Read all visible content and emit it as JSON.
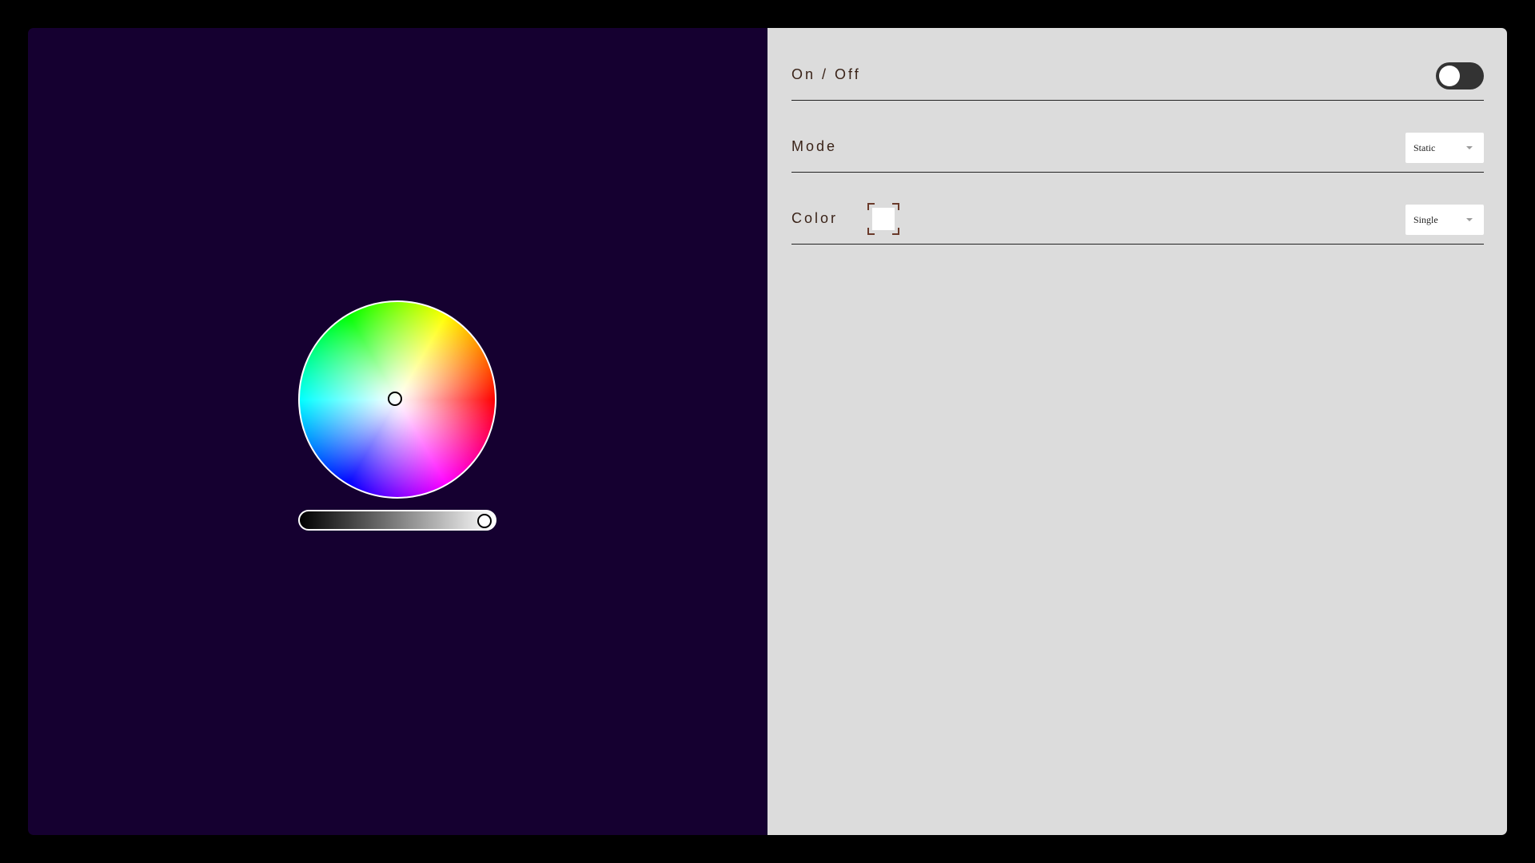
{
  "colors": {
    "stage_background": "#150030",
    "panel_background": "#dcdcdc",
    "toggle_track": "#333333",
    "label_text": "#3a2318",
    "selected_color": "#ffffff"
  },
  "picker": {
    "wheel_icon": "color-wheel",
    "brightness": 1.0
  },
  "settings": {
    "power": {
      "label": "On / Off",
      "state": "off"
    },
    "mode": {
      "label": "Mode",
      "selected": "Static",
      "caret_icon": "chevron-down-icon"
    },
    "color": {
      "label": "Color",
      "swatch_color": "#ffffff",
      "selected": "Single",
      "caret_icon": "chevron-down-icon"
    }
  }
}
